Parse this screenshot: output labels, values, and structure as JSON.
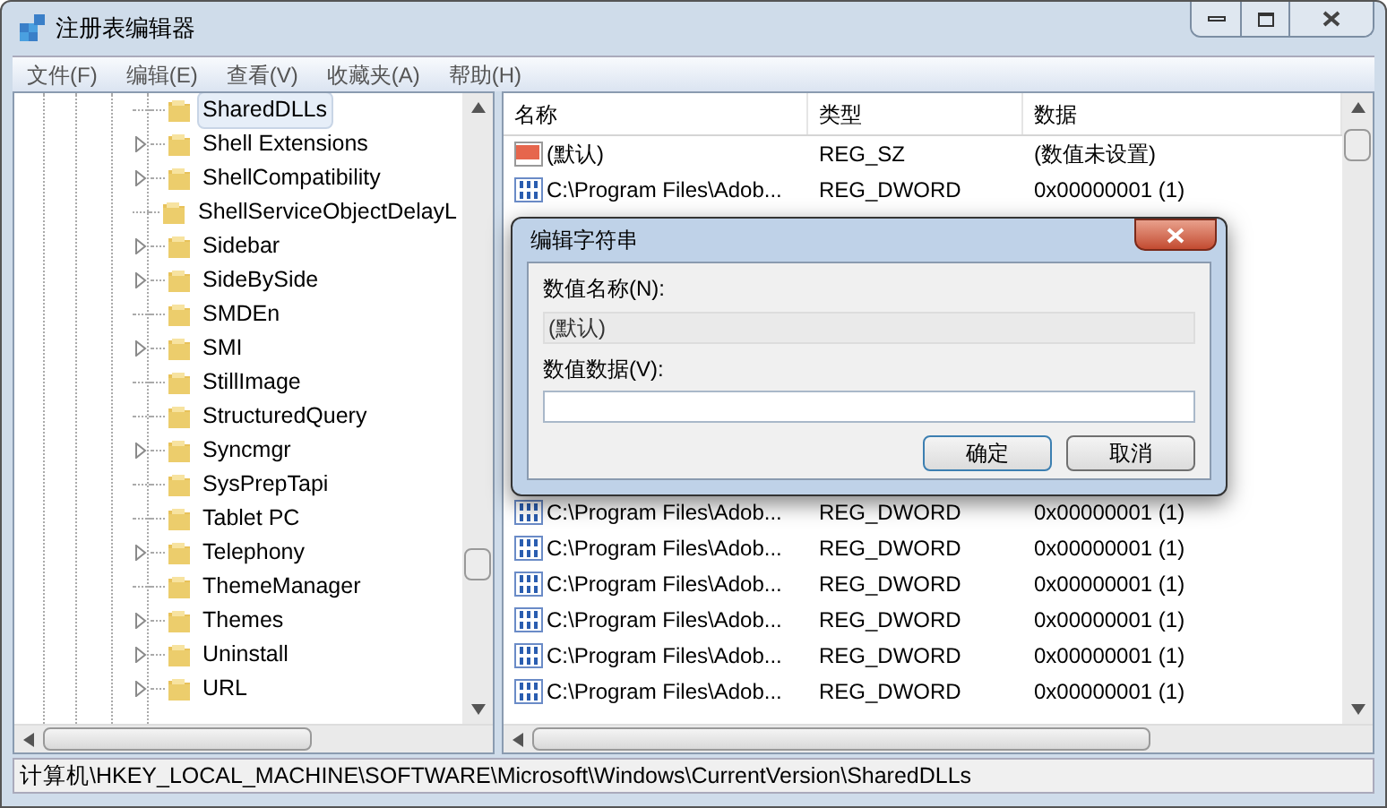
{
  "window": {
    "title": "注册表编辑器"
  },
  "menu": [
    "文件(F)",
    "编辑(E)",
    "查看(V)",
    "收藏夹(A)",
    "帮助(H)"
  ],
  "tree": [
    {
      "label": "SharedDLLs",
      "expandable": false,
      "selected": true
    },
    {
      "label": "Shell Extensions",
      "expandable": true,
      "selected": false
    },
    {
      "label": "ShellCompatibility",
      "expandable": true,
      "selected": false
    },
    {
      "label": "ShellServiceObjectDelayL",
      "expandable": false,
      "selected": false
    },
    {
      "label": "Sidebar",
      "expandable": true,
      "selected": false
    },
    {
      "label": "SideBySide",
      "expandable": true,
      "selected": false
    },
    {
      "label": "SMDEn",
      "expandable": false,
      "selected": false
    },
    {
      "label": "SMI",
      "expandable": true,
      "selected": false
    },
    {
      "label": "StillImage",
      "expandable": false,
      "selected": false
    },
    {
      "label": "StructuredQuery",
      "expandable": false,
      "selected": false
    },
    {
      "label": "Syncmgr",
      "expandable": true,
      "selected": false
    },
    {
      "label": "SysPrepTapi",
      "expandable": false,
      "selected": false
    },
    {
      "label": "Tablet PC",
      "expandable": false,
      "selected": false
    },
    {
      "label": "Telephony",
      "expandable": true,
      "selected": false
    },
    {
      "label": "ThemeManager",
      "expandable": false,
      "selected": false
    },
    {
      "label": "Themes",
      "expandable": true,
      "selected": false
    },
    {
      "label": "Uninstall",
      "expandable": true,
      "selected": false
    },
    {
      "label": "URL",
      "expandable": true,
      "selected": false
    }
  ],
  "table": {
    "columns": [
      "名称",
      "类型",
      "数据"
    ],
    "rows_top": [
      {
        "kind": "string",
        "name": "(默认)",
        "type": "REG_SZ",
        "data": "(数值未设置)"
      },
      {
        "kind": "dword",
        "name": "C:\\Program Files\\Adob...",
        "type": "REG_DWORD",
        "data": "0x00000001 (1)"
      }
    ],
    "rows_bottom": [
      {
        "kind": "dword",
        "name": "C:\\Program Files\\Adob...",
        "type": "REG_DWORD",
        "data": "0x00000001 (1)"
      },
      {
        "kind": "dword",
        "name": "C:\\Program Files\\Adob...",
        "type": "REG_DWORD",
        "data": "0x00000001 (1)"
      },
      {
        "kind": "dword",
        "name": "C:\\Program Files\\Adob...",
        "type": "REG_DWORD",
        "data": "0x00000001 (1)"
      },
      {
        "kind": "dword",
        "name": "C:\\Program Files\\Adob...",
        "type": "REG_DWORD",
        "data": "0x00000001 (1)"
      },
      {
        "kind": "dword",
        "name": "C:\\Program Files\\Adob...",
        "type": "REG_DWORD",
        "data": "0x00000001 (1)"
      },
      {
        "kind": "dword",
        "name": "C:\\Program Files\\Adob...",
        "type": "REG_DWORD",
        "data": "0x00000001 (1)"
      }
    ]
  },
  "status_bar": "计算机\\HKEY_LOCAL_MACHINE\\SOFTWARE\\Microsoft\\Windows\\CurrentVersion\\SharedDLLs",
  "dialog": {
    "title": "编辑字符串",
    "name_label": "数值名称(N):",
    "name_value": "(默认)",
    "data_label": "数值数据(V):",
    "buttons": [
      "确定",
      "取消"
    ]
  }
}
